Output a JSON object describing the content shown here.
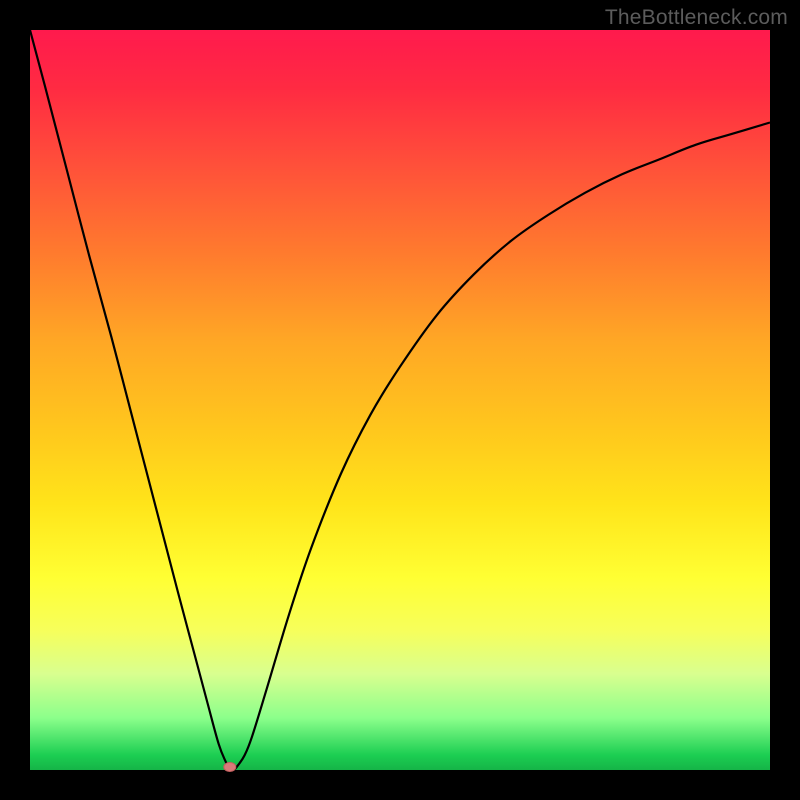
{
  "watermark": "TheBottleneck.com",
  "colors": {
    "frame": "#000000",
    "curve": "#000000",
    "min_marker": "#d97a7a",
    "gradient_top": "#ff1a4d",
    "gradient_bottom": "#15b447"
  },
  "chart_data": {
    "type": "line",
    "title": "",
    "xlabel": "",
    "ylabel": "",
    "xlim": [
      0,
      100
    ],
    "ylim": [
      0,
      100
    ],
    "grid": false,
    "x": [
      0,
      2,
      5,
      8,
      11,
      14,
      17,
      20,
      22,
      24,
      25.5,
      26.5,
      27,
      27.5,
      28,
      29,
      30,
      32,
      35,
      38,
      42,
      46,
      50,
      55,
      60,
      65,
      70,
      75,
      80,
      85,
      90,
      95,
      100
    ],
    "y": [
      100,
      92.5,
      81,
      69.5,
      58.5,
      47,
      35.5,
      24,
      16.5,
      9,
      3.5,
      1,
      0,
      0,
      0.5,
      2,
      4.5,
      11,
      21,
      30,
      40,
      48,
      54.5,
      61.5,
      67,
      71.5,
      75,
      78,
      80.5,
      82.5,
      84.5,
      86,
      87.5
    ],
    "min_point": {
      "x": 27,
      "y": 0
    },
    "annotations": []
  }
}
